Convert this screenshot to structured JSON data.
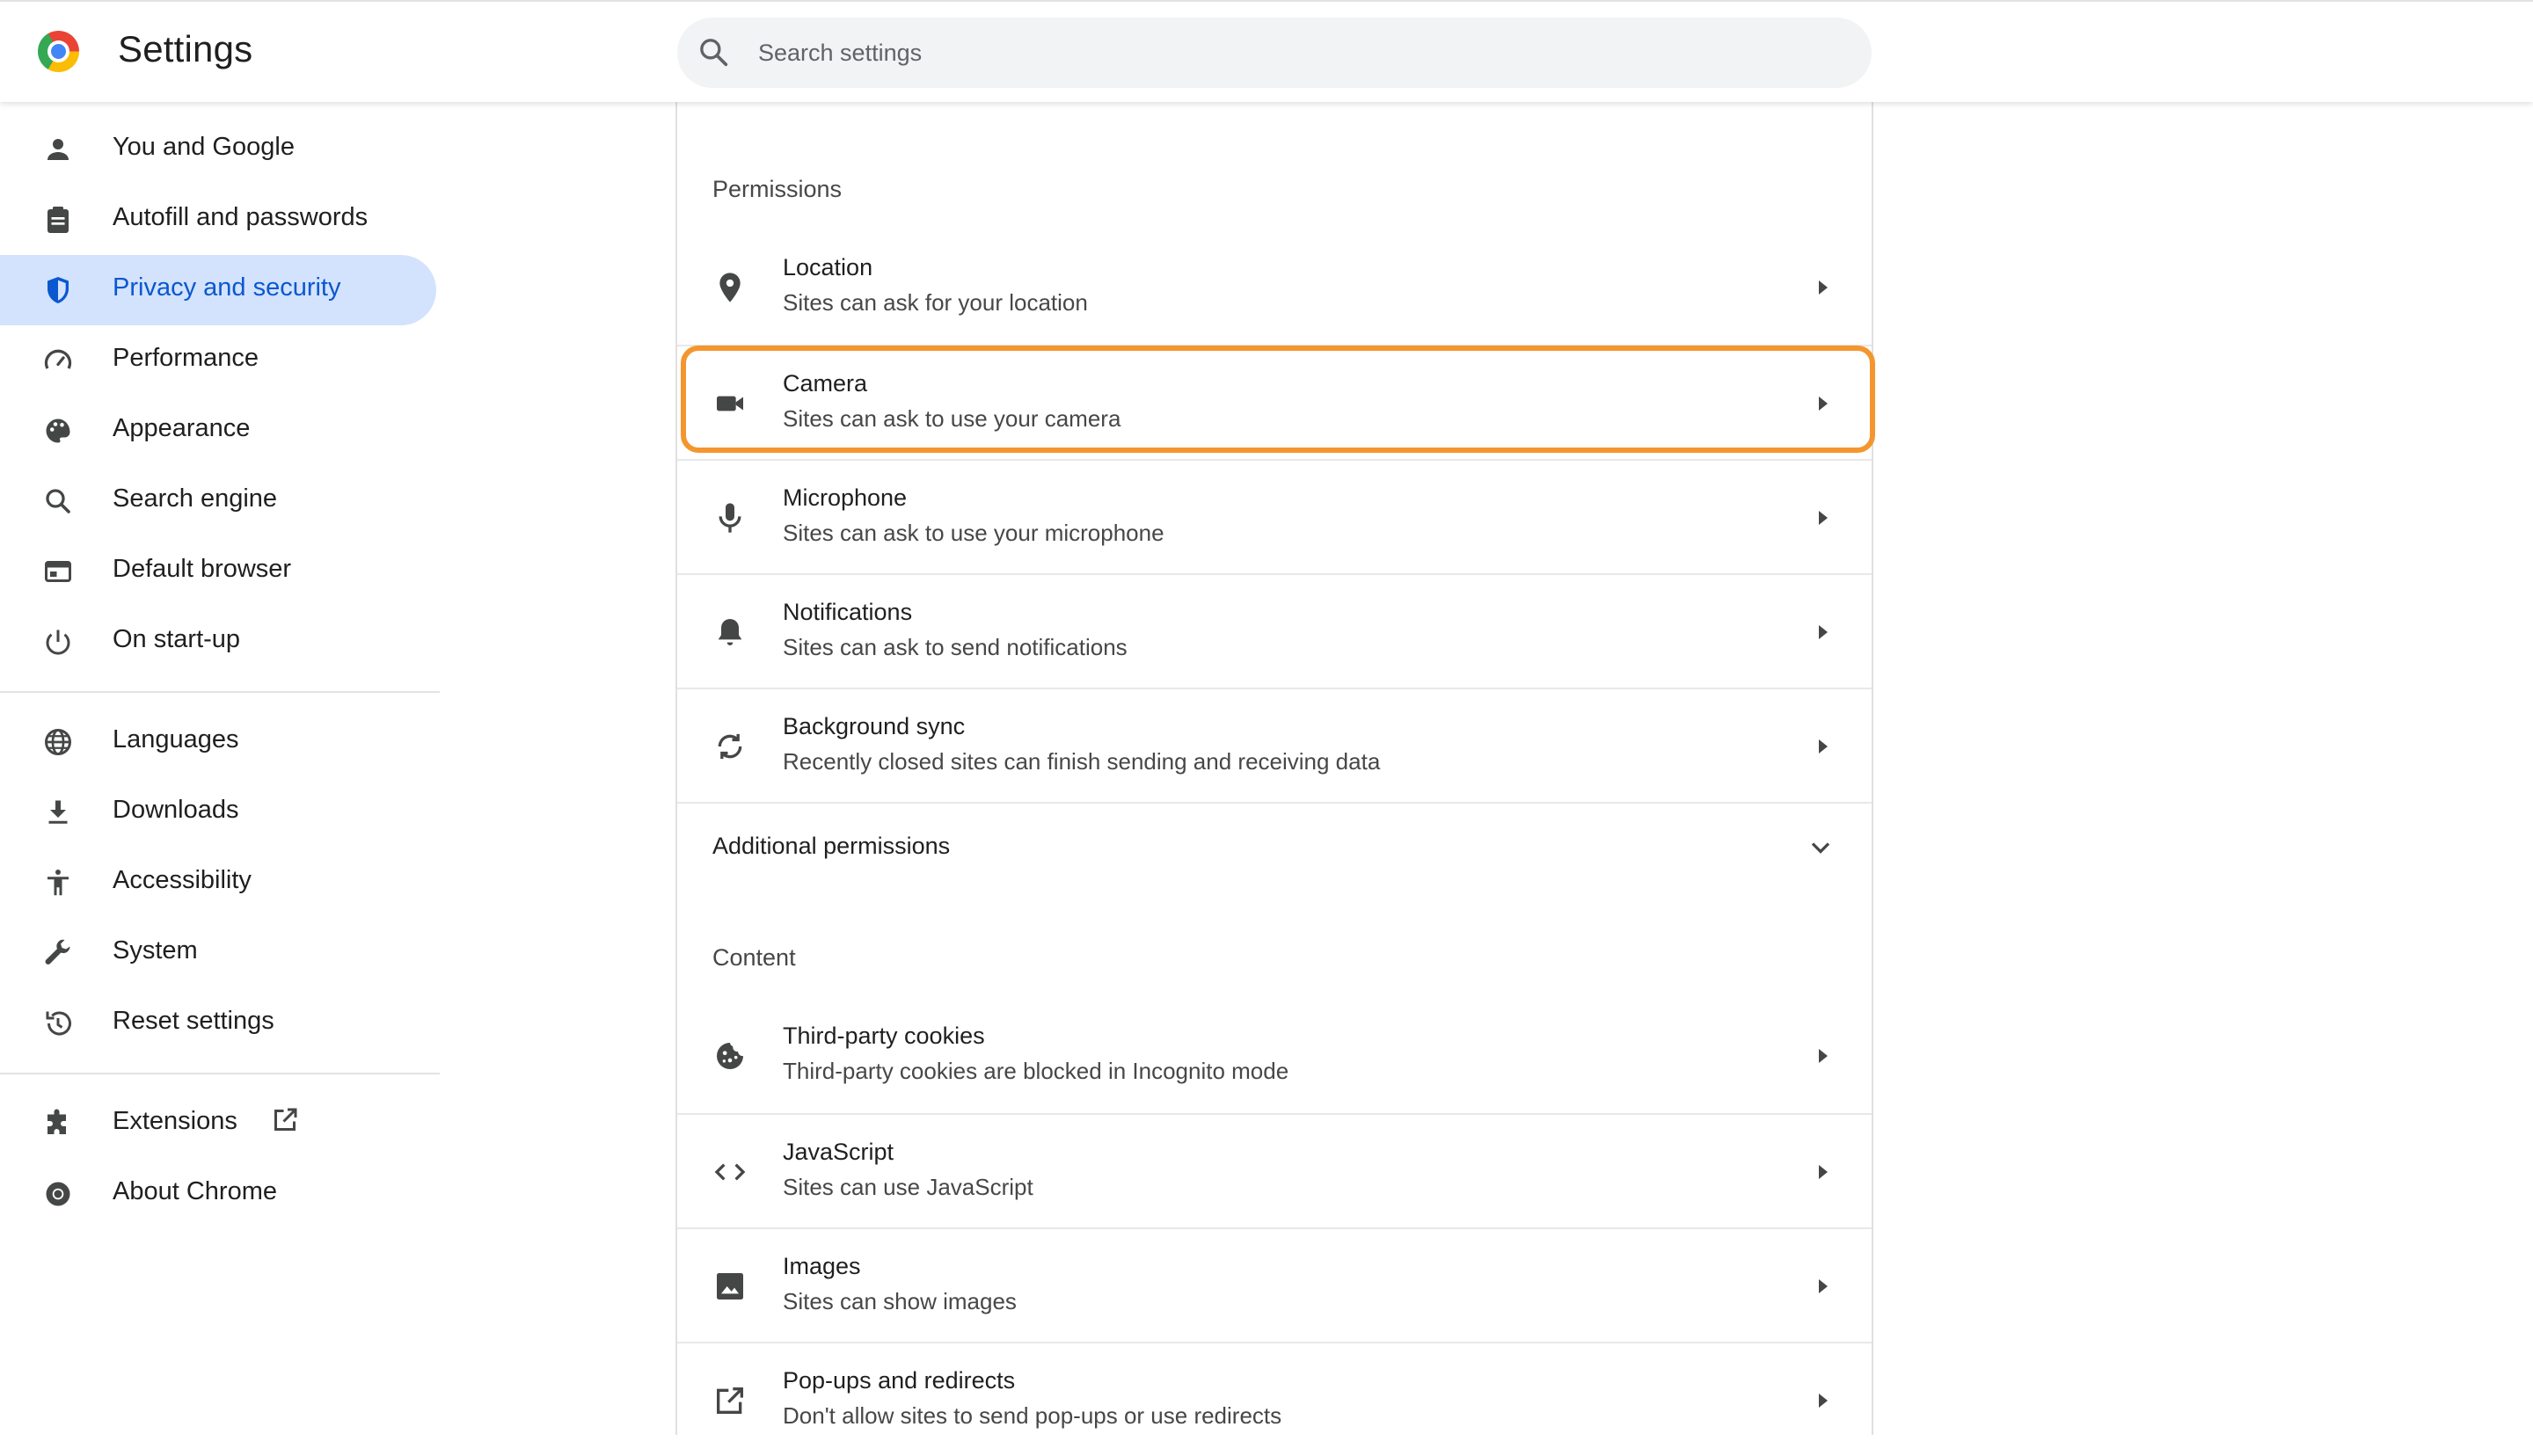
{
  "header": {
    "title": "Settings",
    "search_placeholder": "Search settings"
  },
  "sidebar": {
    "items": [
      {
        "label": "You and Google",
        "icon": "person-icon"
      },
      {
        "label": "Autofill and passwords",
        "icon": "clipboard-icon"
      },
      {
        "label": "Privacy and security",
        "icon": "shield-icon",
        "active": true
      },
      {
        "label": "Performance",
        "icon": "speedometer-icon"
      },
      {
        "label": "Appearance",
        "icon": "palette-icon"
      },
      {
        "label": "Search engine",
        "icon": "search-icon"
      },
      {
        "label": "Default browser",
        "icon": "browser-window-icon"
      },
      {
        "label": "On start-up",
        "icon": "power-icon"
      },
      {
        "label": "Languages",
        "icon": "globe-icon"
      },
      {
        "label": "Downloads",
        "icon": "download-icon"
      },
      {
        "label": "Accessibility",
        "icon": "accessibility-icon"
      },
      {
        "label": "System",
        "icon": "wrench-icon"
      },
      {
        "label": "Reset settings",
        "icon": "history-icon"
      },
      {
        "label": "Extensions",
        "icon": "puzzle-icon"
      },
      {
        "label": "About Chrome",
        "icon": "chrome-icon"
      }
    ]
  },
  "permissions": {
    "section_title": "Permissions",
    "rows": [
      {
        "title": "Location",
        "subtitle": "Sites can ask for your location",
        "icon": "location-pin-icon"
      },
      {
        "title": "Camera",
        "subtitle": "Sites can ask to use your camera",
        "icon": "camera-icon"
      },
      {
        "title": "Microphone",
        "subtitle": "Sites can ask to use your microphone",
        "icon": "microphone-icon"
      },
      {
        "title": "Notifications",
        "subtitle": "Sites can ask to send notifications",
        "icon": "bell-icon"
      },
      {
        "title": "Background sync",
        "subtitle": "Recently closed sites can finish sending and receiving data",
        "icon": "sync-icon"
      }
    ],
    "additional": "Additional permissions"
  },
  "content": {
    "section_title": "Content",
    "rows": [
      {
        "title": "Third-party cookies",
        "subtitle": "Third-party cookies are blocked in Incognito mode",
        "icon": "cookie-icon"
      },
      {
        "title": "JavaScript",
        "subtitle": "Sites can use JavaScript",
        "icon": "code-icon"
      },
      {
        "title": "Images",
        "subtitle": "Sites can show images",
        "icon": "image-icon"
      },
      {
        "title": "Pop-ups and redirects",
        "subtitle": "Don't allow sites to send pop-ups or use redirects",
        "icon": "open-in-new-icon"
      }
    ]
  },
  "colors": {
    "accent": "#0b57d0",
    "active_bg": "#d3e3fd",
    "highlight": "#f4962f"
  }
}
